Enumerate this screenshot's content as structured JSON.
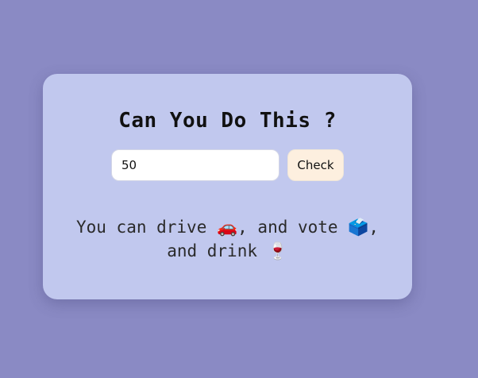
{
  "card": {
    "title": "Can You Do This ?",
    "age_input": {
      "value": "50",
      "placeholder": ""
    },
    "check_label": "Check",
    "result_text": "You can drive 🚗, and vote 🗳️, and drink 🍷"
  },
  "colors": {
    "page_background": "#8a8ac4",
    "card_background": "#c1c8ee",
    "button_background": "#fdefdf"
  }
}
